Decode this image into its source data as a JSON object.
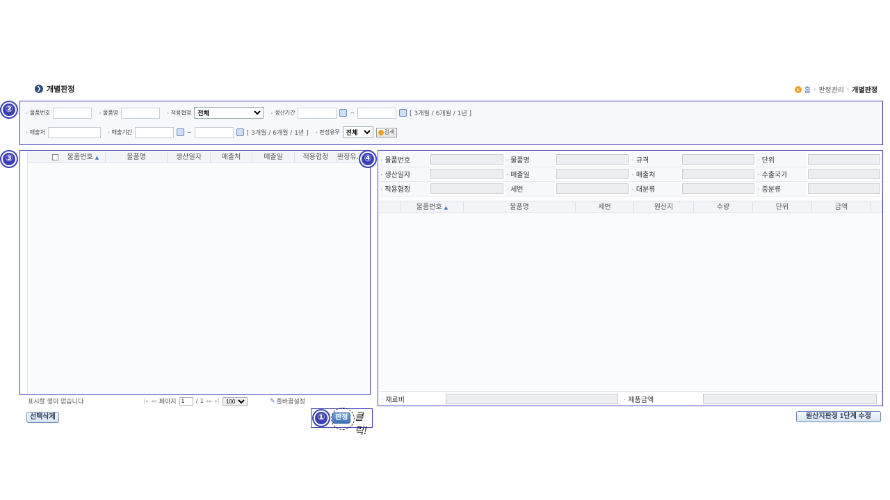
{
  "header": {
    "title": "개별판정",
    "breadcrumb": [
      "홈",
      "판정관리",
      "개별판정"
    ]
  },
  "badges": [
    "①",
    "②",
    "③",
    "④"
  ],
  "search": {
    "row1": {
      "item_no_label": "물품번호",
      "item_name_label": "물품명",
      "agreement_label": "적용협정",
      "agreement_value": "전체",
      "prod_period_label": "생산기간",
      "tilde": "~",
      "period_links": "[ 3개월 / 6개월 / 1년 ]"
    },
    "row2": {
      "buyer_label": "매출처",
      "sale_period_label": "매출기간",
      "tilde": "~",
      "period_links": "[ 3개월 / 6개월 / 1년 ]",
      "judged_label": "판정유무",
      "judged_value": "전체",
      "search_button": "검색"
    }
  },
  "left_grid": {
    "columns": [
      "물품번호",
      "물품명",
      "생산일자",
      "매출처",
      "매출일",
      "적용협정",
      "판정유..."
    ],
    "empty_text": "표시할 행이 없습니다",
    "page_label": "페이지",
    "page_value": "1",
    "page_total": "/ 1",
    "page_size": "100",
    "column_settings": "줄바꿈설정",
    "delete_button": "선택삭제"
  },
  "right_panel": {
    "fields": [
      [
        "물품번호",
        "물품명",
        "규격",
        "단위"
      ],
      [
        "생산일자",
        "매출일",
        "매출처",
        "수출국가"
      ],
      [
        "적용협정",
        "세번",
        "대분류",
        "중분류"
      ]
    ],
    "columns": [
      "물품번호",
      "물품명",
      "세번",
      "원산지",
      "수량",
      "단위",
      "금액"
    ],
    "material_cost_label": "재료비",
    "product_amount_label": "제품금액",
    "edit_button": "원산지판정 1단계 수정"
  },
  "action": {
    "judge_button": "판정",
    "click_hint": "클릭!"
  }
}
